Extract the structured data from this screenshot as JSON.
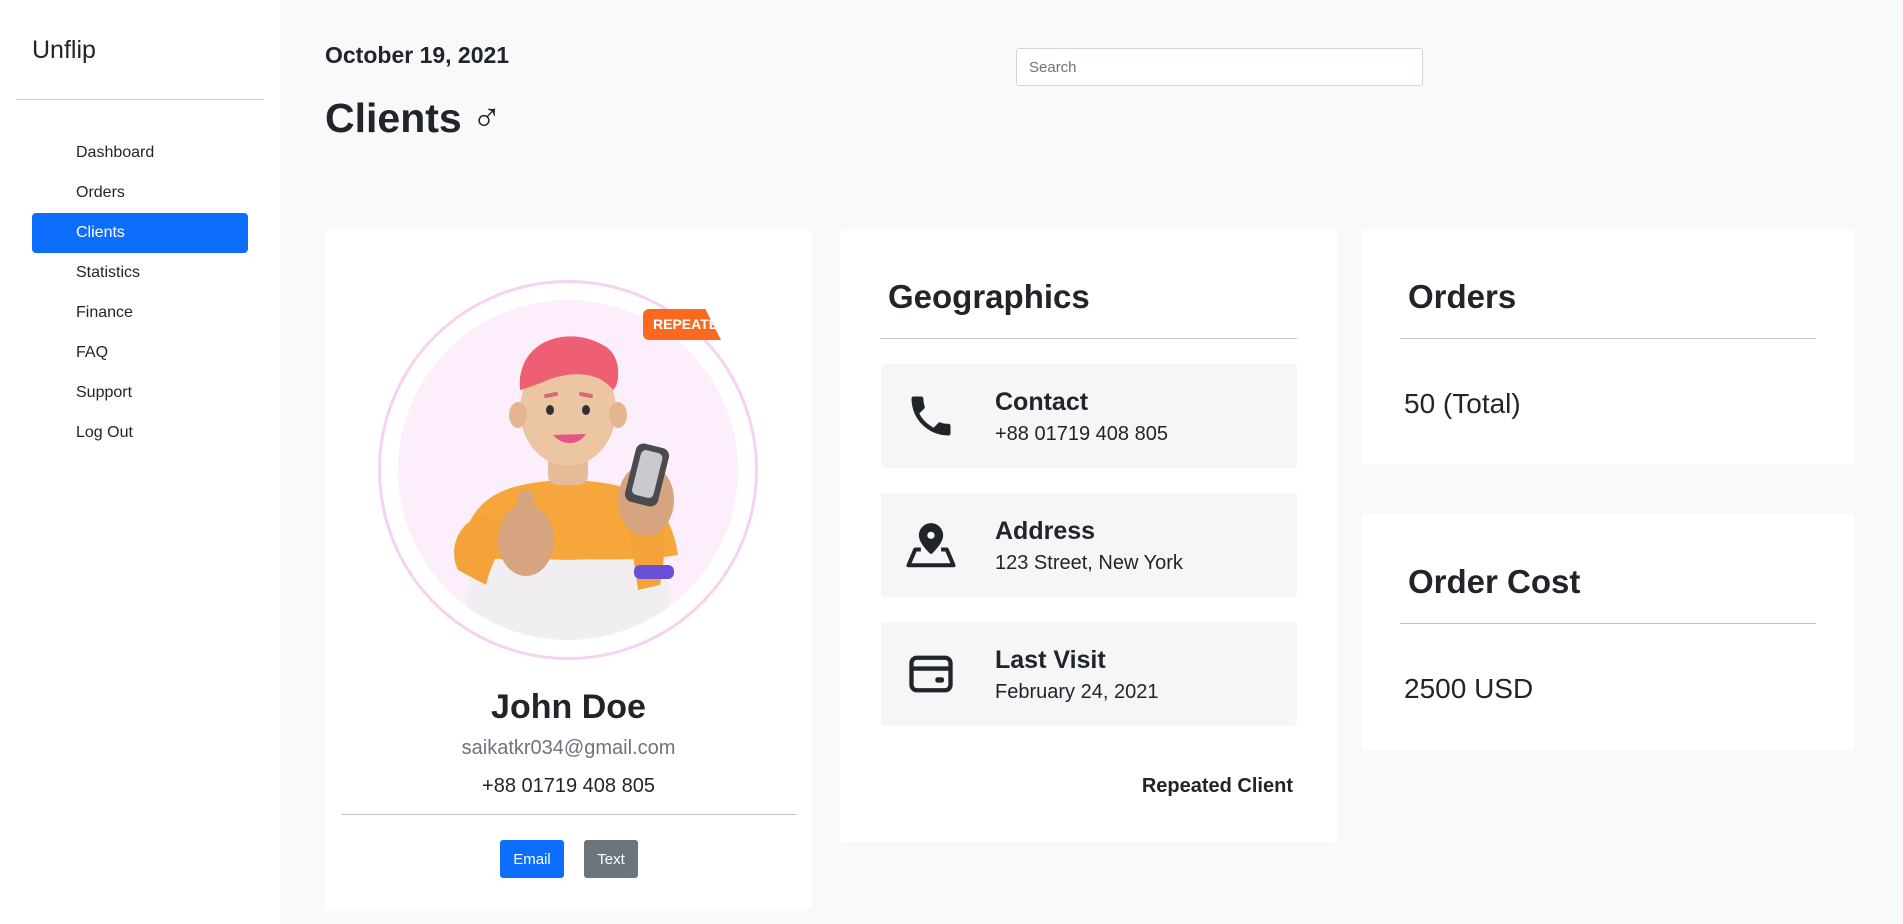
{
  "sidebar": {
    "brand": "Unflip",
    "items": [
      {
        "label": "Dashboard"
      },
      {
        "label": "Orders"
      },
      {
        "label": "Clients",
        "active": true
      },
      {
        "label": "Statistics"
      },
      {
        "label": "Finance"
      },
      {
        "label": "FAQ"
      },
      {
        "label": "Support"
      },
      {
        "label": "Log Out"
      }
    ]
  },
  "header": {
    "date": "October 19, 2021",
    "title": "Clients",
    "title_symbol": "♂",
    "search_placeholder": "Search"
  },
  "profile": {
    "badge": "REPEATED",
    "name": "John Doe",
    "email": "saikatkr034@gmail.com",
    "phone": "+88 01719 408 805",
    "email_button": "Email",
    "text_button": "Text"
  },
  "geographics": {
    "title": "Geographics",
    "items": [
      {
        "label": "Contact",
        "value": "+88 01719 408 805",
        "icon": "phone-icon"
      },
      {
        "label": "Address",
        "value": "123 Street, New York",
        "icon": "map-pin-icon"
      },
      {
        "label": "Last Visit",
        "value": "February 24, 2021",
        "icon": "credit-card-icon"
      }
    ],
    "footer": "Repeated Client"
  },
  "orders": {
    "title": "Orders",
    "value": "50 (Total)"
  },
  "order_cost": {
    "title": "Order Cost",
    "value": "2500 USD"
  },
  "colors": {
    "primary": "#0d6efd",
    "secondary": "#6c757d",
    "background": "#f8f9fa",
    "badge": "#f96a20"
  }
}
